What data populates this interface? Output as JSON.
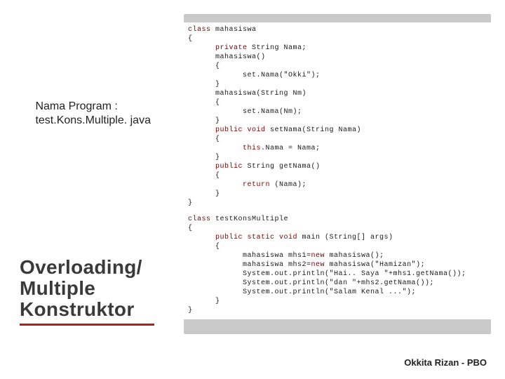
{
  "bullet": {
    "line1": "Nama Program :",
    "line2": "test.Kons.Multiple. java"
  },
  "title": {
    "line1": "Overloading/",
    "line2": "Multiple",
    "line3": "Konstruktor"
  },
  "footer": "Okkita Rizan - PBO",
  "code": {
    "l01a": "class",
    "l01b": " mahasiswa",
    "l02": "{",
    "l03a": "      private",
    "l03b": " String Nama;",
    "l04": "",
    "l05": "      mahasiswa()",
    "l06": "      {",
    "l07": "            set.Nama(\"Okki\");",
    "l08": "      }",
    "l09": "      mahasiswa(String Nm)",
    "l10": "      {",
    "l11": "            set.Nama(Nm);",
    "l12": "      }",
    "l13a": "      public void",
    "l13b": " setNama(String Nama)",
    "l14": "      {",
    "l15a": "            this",
    "l15b": ".Nama = Nama;",
    "l16": "      }",
    "l17a": "      public",
    "l17b": " String getNama()",
    "l18": "      {",
    "l19a": "            return",
    "l19b": " (Nama);",
    "l20": "      }",
    "l21": "}",
    "l22": "",
    "l23a": "class",
    "l23b": " testKonsMultiple",
    "l24": "{",
    "l25a": "      public static void",
    "l25b": " main (String[] args)",
    "l26": "      {",
    "l27a": "            mahasiswa mhs1=",
    "l27b": "new",
    "l27c": " mahasiswa();",
    "l28a": "            mahasiswa mhs2=",
    "l28b": "new",
    "l28c": " mahasiswa(\"Hamizan\");",
    "l29": "",
    "l30": "            System.out.println(\"Hai.. Saya \"+mhs1.getNama());",
    "l31": "            System.out.println(\"dan \"+mhs2.getNama());",
    "l32": "            System.out.println(\"Salam Kenal ...\");",
    "l33": "      }",
    "l34": "}"
  }
}
